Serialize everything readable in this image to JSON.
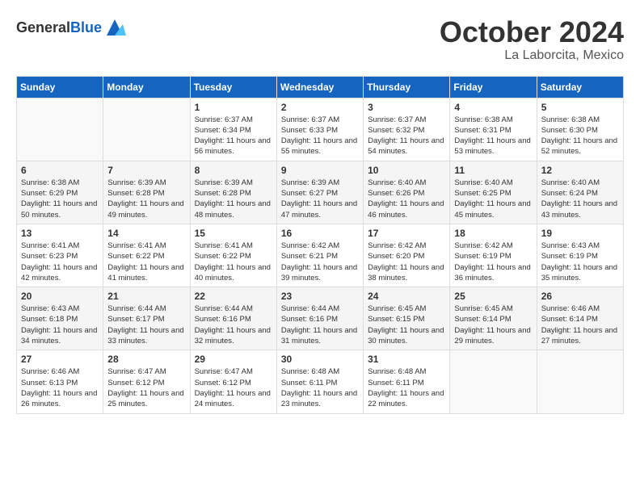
{
  "header": {
    "logo_general": "General",
    "logo_blue": "Blue",
    "month": "October 2024",
    "location": "La Laborcita, Mexico"
  },
  "weekdays": [
    "Sunday",
    "Monday",
    "Tuesday",
    "Wednesday",
    "Thursday",
    "Friday",
    "Saturday"
  ],
  "weeks": [
    [
      {
        "day": "",
        "info": ""
      },
      {
        "day": "",
        "info": ""
      },
      {
        "day": "1",
        "info": "Sunrise: 6:37 AM\nSunset: 6:34 PM\nDaylight: 11 hours and 56 minutes."
      },
      {
        "day": "2",
        "info": "Sunrise: 6:37 AM\nSunset: 6:33 PM\nDaylight: 11 hours and 55 minutes."
      },
      {
        "day": "3",
        "info": "Sunrise: 6:37 AM\nSunset: 6:32 PM\nDaylight: 11 hours and 54 minutes."
      },
      {
        "day": "4",
        "info": "Sunrise: 6:38 AM\nSunset: 6:31 PM\nDaylight: 11 hours and 53 minutes."
      },
      {
        "day": "5",
        "info": "Sunrise: 6:38 AM\nSunset: 6:30 PM\nDaylight: 11 hours and 52 minutes."
      }
    ],
    [
      {
        "day": "6",
        "info": "Sunrise: 6:38 AM\nSunset: 6:29 PM\nDaylight: 11 hours and 50 minutes."
      },
      {
        "day": "7",
        "info": "Sunrise: 6:39 AM\nSunset: 6:28 PM\nDaylight: 11 hours and 49 minutes."
      },
      {
        "day": "8",
        "info": "Sunrise: 6:39 AM\nSunset: 6:28 PM\nDaylight: 11 hours and 48 minutes."
      },
      {
        "day": "9",
        "info": "Sunrise: 6:39 AM\nSunset: 6:27 PM\nDaylight: 11 hours and 47 minutes."
      },
      {
        "day": "10",
        "info": "Sunrise: 6:40 AM\nSunset: 6:26 PM\nDaylight: 11 hours and 46 minutes."
      },
      {
        "day": "11",
        "info": "Sunrise: 6:40 AM\nSunset: 6:25 PM\nDaylight: 11 hours and 45 minutes."
      },
      {
        "day": "12",
        "info": "Sunrise: 6:40 AM\nSunset: 6:24 PM\nDaylight: 11 hours and 43 minutes."
      }
    ],
    [
      {
        "day": "13",
        "info": "Sunrise: 6:41 AM\nSunset: 6:23 PM\nDaylight: 11 hours and 42 minutes."
      },
      {
        "day": "14",
        "info": "Sunrise: 6:41 AM\nSunset: 6:22 PM\nDaylight: 11 hours and 41 minutes."
      },
      {
        "day": "15",
        "info": "Sunrise: 6:41 AM\nSunset: 6:22 PM\nDaylight: 11 hours and 40 minutes."
      },
      {
        "day": "16",
        "info": "Sunrise: 6:42 AM\nSunset: 6:21 PM\nDaylight: 11 hours and 39 minutes."
      },
      {
        "day": "17",
        "info": "Sunrise: 6:42 AM\nSunset: 6:20 PM\nDaylight: 11 hours and 38 minutes."
      },
      {
        "day": "18",
        "info": "Sunrise: 6:42 AM\nSunset: 6:19 PM\nDaylight: 11 hours and 36 minutes."
      },
      {
        "day": "19",
        "info": "Sunrise: 6:43 AM\nSunset: 6:19 PM\nDaylight: 11 hours and 35 minutes."
      }
    ],
    [
      {
        "day": "20",
        "info": "Sunrise: 6:43 AM\nSunset: 6:18 PM\nDaylight: 11 hours and 34 minutes."
      },
      {
        "day": "21",
        "info": "Sunrise: 6:44 AM\nSunset: 6:17 PM\nDaylight: 11 hours and 33 minutes."
      },
      {
        "day": "22",
        "info": "Sunrise: 6:44 AM\nSunset: 6:16 PM\nDaylight: 11 hours and 32 minutes."
      },
      {
        "day": "23",
        "info": "Sunrise: 6:44 AM\nSunset: 6:16 PM\nDaylight: 11 hours and 31 minutes."
      },
      {
        "day": "24",
        "info": "Sunrise: 6:45 AM\nSunset: 6:15 PM\nDaylight: 11 hours and 30 minutes."
      },
      {
        "day": "25",
        "info": "Sunrise: 6:45 AM\nSunset: 6:14 PM\nDaylight: 11 hours and 29 minutes."
      },
      {
        "day": "26",
        "info": "Sunrise: 6:46 AM\nSunset: 6:14 PM\nDaylight: 11 hours and 27 minutes."
      }
    ],
    [
      {
        "day": "27",
        "info": "Sunrise: 6:46 AM\nSunset: 6:13 PM\nDaylight: 11 hours and 26 minutes."
      },
      {
        "day": "28",
        "info": "Sunrise: 6:47 AM\nSunset: 6:12 PM\nDaylight: 11 hours and 25 minutes."
      },
      {
        "day": "29",
        "info": "Sunrise: 6:47 AM\nSunset: 6:12 PM\nDaylight: 11 hours and 24 minutes."
      },
      {
        "day": "30",
        "info": "Sunrise: 6:48 AM\nSunset: 6:11 PM\nDaylight: 11 hours and 23 minutes."
      },
      {
        "day": "31",
        "info": "Sunrise: 6:48 AM\nSunset: 6:11 PM\nDaylight: 11 hours and 22 minutes."
      },
      {
        "day": "",
        "info": ""
      },
      {
        "day": "",
        "info": ""
      }
    ]
  ]
}
